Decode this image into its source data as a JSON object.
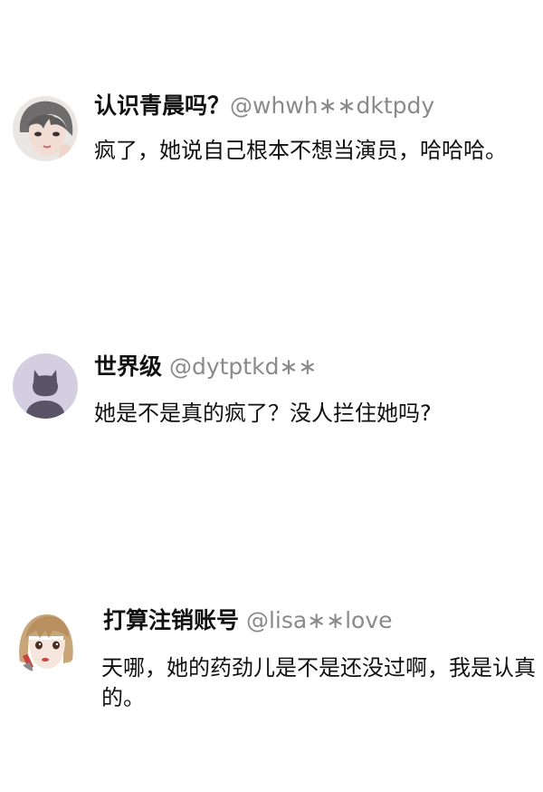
{
  "comments": [
    {
      "username": "认识青晨吗？",
      "handle": "@whwh∗∗dktpdy",
      "text": "疯了，她说自己根本不想当演员，哈哈哈。",
      "avatar_icon": "anime-boy-avatar"
    },
    {
      "username": "世界级",
      "handle": "@dytptkd∗∗",
      "text": "她是不是真的疯了？没人拦住她吗?",
      "avatar_icon": "cat-silhouette-avatar"
    },
    {
      "username": "打算注销账号",
      "handle": "@lisa∗∗love",
      "text": "天哪，她的药劲儿是不是还没过啊，我是认真的。",
      "avatar_icon": "anime-girl-lipstick-avatar"
    }
  ],
  "colors": {
    "username": "#111111",
    "handle": "#8a8a8a",
    "text": "#111111",
    "avatar2_bg": "#d4cfe0",
    "avatar2_fg": "#5a5468"
  }
}
